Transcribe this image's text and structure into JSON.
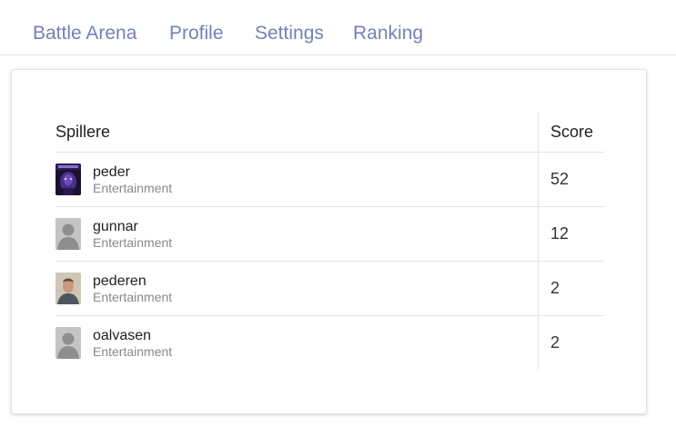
{
  "nav": {
    "items": [
      {
        "label": "Battle Arena"
      },
      {
        "label": "Profile"
      },
      {
        "label": "Settings"
      },
      {
        "label": "Ranking"
      }
    ],
    "color": "#7481b6"
  },
  "leaderboard": {
    "headers": {
      "players": "Spillere",
      "score": "Score"
    },
    "rows": [
      {
        "name": "peder",
        "group": "Entertainment",
        "score": "52",
        "avatar": "game-art-avatar"
      },
      {
        "name": "gunnar",
        "group": "Entertainment",
        "score": "12",
        "avatar": "default-user-avatar"
      },
      {
        "name": "pederen",
        "group": "Entertainment",
        "score": "2",
        "avatar": "photo-avatar"
      },
      {
        "name": "oalvasen",
        "group": "Entertainment",
        "score": "2",
        "avatar": "default-user-avatar"
      }
    ]
  }
}
